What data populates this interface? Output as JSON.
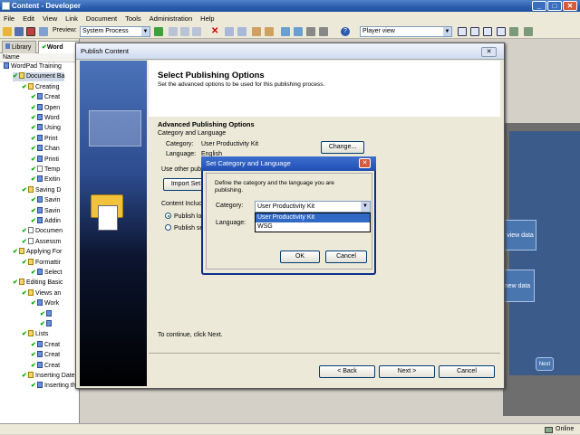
{
  "window": {
    "title": "Content - Developer"
  },
  "menu": [
    "File",
    "Edit",
    "View",
    "Link",
    "Document",
    "Tools",
    "Administration",
    "Help"
  ],
  "toolbar": {
    "preview_label": "Preview:",
    "preview_value": "System Process",
    "player_value": "Player view"
  },
  "left_tabs": [
    "Library",
    "Word"
  ],
  "tree": {
    "header": "Name",
    "items": [
      {
        "label": "WordPad Training",
        "type": "module"
      },
      {
        "label": "Document Ba",
        "type": "section"
      },
      {
        "label": "Creating",
        "type": "section"
      },
      {
        "label": "Creat",
        "type": "topic"
      },
      {
        "label": "Open",
        "type": "topic"
      },
      {
        "label": "Word",
        "type": "topic"
      },
      {
        "label": "Using",
        "type": "topic"
      },
      {
        "label": "Print",
        "type": "topic"
      },
      {
        "label": "Chan",
        "type": "topic"
      },
      {
        "label": "Printi",
        "type": "topic"
      },
      {
        "label": "Temp",
        "type": "doc"
      },
      {
        "label": "Exitin",
        "type": "topic"
      },
      {
        "label": "Saving D",
        "type": "section"
      },
      {
        "label": "Savin",
        "type": "topic"
      },
      {
        "label": "Savin",
        "type": "topic"
      },
      {
        "label": "Addin",
        "type": "topic"
      },
      {
        "label": "Documen",
        "type": "doc"
      },
      {
        "label": "Assessm",
        "type": "doc"
      },
      {
        "label": "Applying For",
        "type": "section"
      },
      {
        "label": "Formattir",
        "type": "section"
      },
      {
        "label": "Select",
        "type": "topic"
      },
      {
        "label": "Editing Basic",
        "type": "section"
      },
      {
        "label": "Views an",
        "type": "section"
      },
      {
        "label": "Work",
        "type": "topic"
      },
      {
        "label": "",
        "type": "topic"
      },
      {
        "label": "",
        "type": "topic"
      },
      {
        "label": "Lists",
        "type": "section"
      },
      {
        "label": "Creat",
        "type": "topic"
      },
      {
        "label": "Creat",
        "type": "topic"
      },
      {
        "label": "Creat",
        "type": "topic"
      },
      {
        "label": "Inserting Dates and Objects",
        "type": "section"
      },
      {
        "label": "Inserting the Date",
        "type": "topic"
      }
    ]
  },
  "preview": {
    "box1": "view data",
    "box2": "new data",
    "next": "Next"
  },
  "status": {
    "text": "Online"
  },
  "publish_dialog": {
    "title": "Publish Content",
    "heading": "Select Publishing Options",
    "subheading": "Set the advanced options to be used for this publishing process.",
    "advanced_title": "Advanced Publishing Options",
    "cat_lang_title": "Category and Language",
    "category_label": "Category:",
    "category_value": "User Productivity Kit",
    "language_label": "Language:",
    "language_value": "English",
    "change_button": "Change...",
    "use_other": "Use other publ",
    "import_button": "Import Set",
    "content_include": "Content Includ",
    "radio1": "Publish loc",
    "radio2": "Publish sel",
    "footer_text": "To continue, click Next.",
    "back_button": "< Back",
    "next_button": "Next >",
    "cancel_button": "Cancel"
  },
  "category_dialog": {
    "title": "Set Category and Language",
    "description": "Define the category and the language you are publishing.",
    "category_label": "Category:",
    "category_value": "User Productivity Kit",
    "options": [
      "User Productivity Kit",
      "WSG"
    ],
    "language_label": "Language:",
    "ok_button": "OK",
    "cancel_button": "Cancel"
  }
}
